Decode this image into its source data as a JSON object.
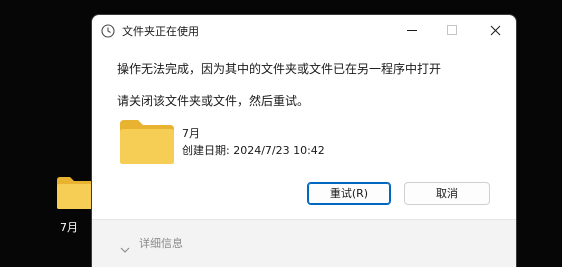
{
  "desktop": {
    "folder_label": "7月"
  },
  "dialog": {
    "title": "文件夹正在使用",
    "message": "操作无法完成，因为其中的文件夹或文件已在另一程序中打开",
    "instruction": "请关闭该文件夹或文件，然后重试。",
    "file": {
      "name": "7月",
      "created": "创建日期: 2024/7/23 10:42"
    },
    "buttons": {
      "retry": "重试(R)",
      "cancel": "取消"
    },
    "details_label": "详细信息"
  },
  "colors": {
    "accent": "#0067c0",
    "folder_yellow": "#f4c84a",
    "folder_back": "#e8b331"
  },
  "icons": {
    "title": "clock-icon",
    "folder": "folder-icon",
    "minimize": "minimize-icon",
    "maximize": "maximize-icon",
    "close": "close-icon",
    "expand": "chevron-down-icon"
  }
}
